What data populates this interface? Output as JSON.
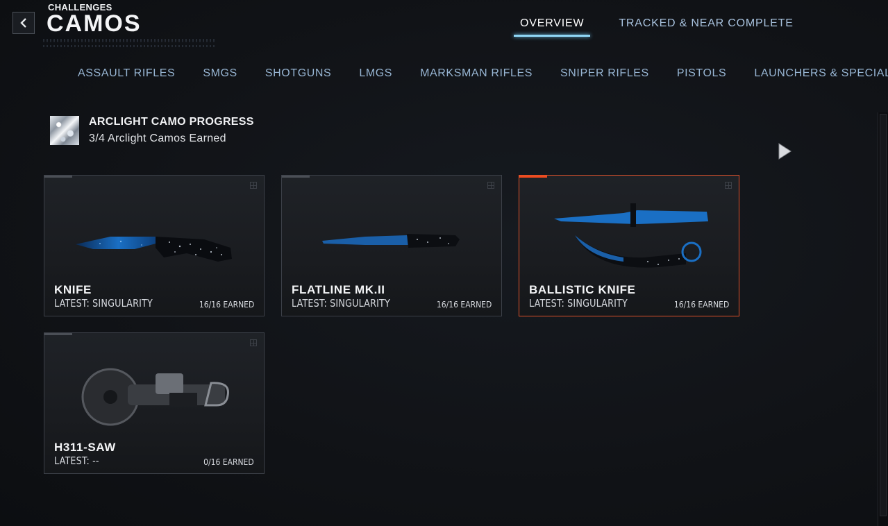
{
  "header": {
    "breadcrumb": "CHALLENGES",
    "title": "CAMOS"
  },
  "top_tabs": [
    {
      "label": "OVERVIEW",
      "active": true
    },
    {
      "label": "TRACKED & NEAR COMPLETE",
      "active": false
    }
  ],
  "category_tabs": [
    "ASSAULT RIFLES",
    "SMGS",
    "SHOTGUNS",
    "LMGS",
    "MARKSMAN RIFLES",
    "SNIPER RIFLES",
    "PISTOLS",
    "LAUNCHERS & SPECIALS"
  ],
  "progress": {
    "title": "ARCLIGHT CAMO PROGRESS",
    "subtitle": "3/4 Arclight Camos Earned"
  },
  "cards": [
    {
      "name": "KNIFE",
      "latest": "LATEST: SINGULARITY",
      "earned": "16/16 EARNED",
      "selected": false,
      "icon": "knife"
    },
    {
      "name": "FLATLINE MK.II",
      "latest": "LATEST: SINGULARITY",
      "earned": "16/16 EARNED",
      "selected": false,
      "icon": "flatline"
    },
    {
      "name": "BALLISTIC KNIFE",
      "latest": "LATEST: SINGULARITY",
      "earned": "16/16 EARNED",
      "selected": true,
      "icon": "ballistic-knife"
    },
    {
      "name": "H311-SAW",
      "latest": "LATEST: --",
      "earned": "0/16 EARNED",
      "selected": false,
      "icon": "saw"
    }
  ],
  "colors": {
    "accent_tab": "#8fd6f5",
    "selected_border": "#e0522a",
    "background": "#101216"
  }
}
